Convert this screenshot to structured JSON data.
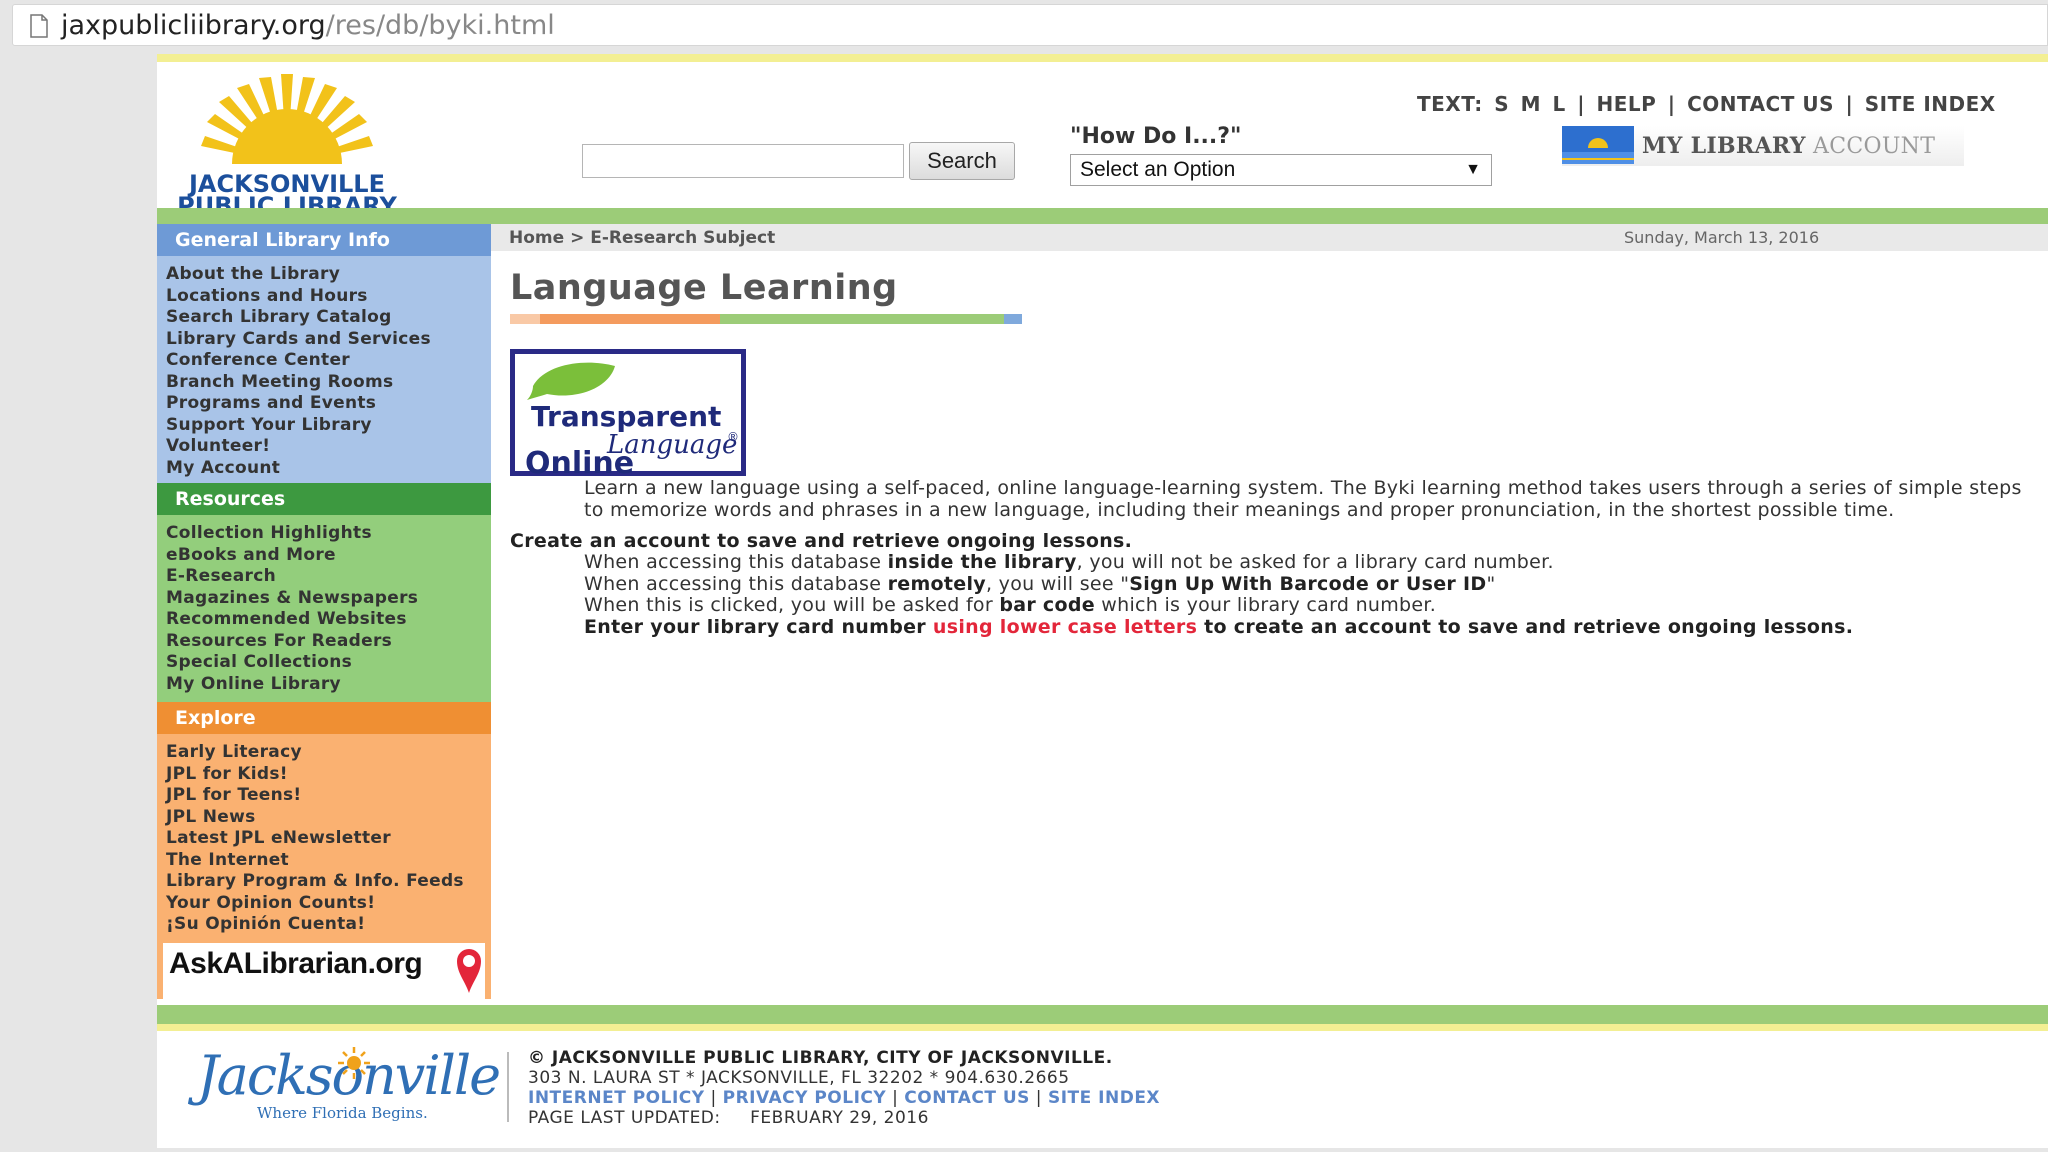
{
  "browser": {
    "url_host": "jaxpublicliibrary.org",
    "url_path": "/res/db/byki.html"
  },
  "header": {
    "logo_line1": "JACKSONVILLE",
    "logo_line2": "PUBLIC LIBRARY",
    "search_button": "Search",
    "search_value": "",
    "howdo_label": "\"How Do I...?\"",
    "select_value": "Select an Option",
    "toplinks": {
      "text_label": "TEXT:",
      "s": "S",
      "m": "M",
      "l": "L",
      "sep": "|",
      "help": "HELP",
      "contact": "CONTACT US",
      "index": "SITE INDEX"
    },
    "account_bold": "MY LIBRARY",
    "account_light": " ACCOUNT"
  },
  "sidebar": {
    "general": {
      "title": "General Library Info",
      "items": [
        "About the Library",
        "Locations and Hours",
        "Search Library Catalog",
        "Library Cards and Services",
        "Conference Center",
        "Branch Meeting Rooms",
        "Programs and Events",
        "Support Your Library",
        "Volunteer!",
        "My Account"
      ]
    },
    "resources": {
      "title": "Resources",
      "items": [
        "Collection Highlights",
        "eBooks and More",
        "E-Research",
        "Magazines & Newspapers",
        "Recommended Websites",
        "Resources For Readers",
        "Special Collections",
        "My Online Library"
      ]
    },
    "explore": {
      "title": "Explore",
      "items": [
        "Early Literacy",
        "JPL for Kids!",
        "JPL for Teens!",
        "JPL News",
        "Latest JPL eNewsletter",
        "The Internet",
        "Library Program & Info. Feeds",
        "Your Opinion Counts!",
        "¡Su Opinión Cuenta!"
      ]
    },
    "ask_label": "AskALibrarian.org"
  },
  "main": {
    "breadcrumb_home": "Home",
    "breadcrumb_sep": " > ",
    "breadcrumb_current": "E-Research Subject",
    "date": "Sunday, March 13, 2016",
    "title": "Language Learning",
    "tl_logo": {
      "line1": "Transparent",
      "line2": "Language",
      "line3": "Online",
      "reg": "®"
    },
    "intro": "Learn a new language using a self-paced, online language-learning system. The Byki learning method takes users through a series of simple steps to memorize words and phrases in a new language, including their meanings and proper pronunciation, in the shortest possible time.",
    "create_heading": "Create an account to save and retrieve ongoing lessons.",
    "line1_a": "When accessing this database ",
    "line1_b": "inside the library",
    "line1_c": ", you will not be asked for a library card number.",
    "line2_a": "When accessing this database ",
    "line2_b": "remotely",
    "line2_c": ", you will see \"",
    "line2_d": "Sign Up With Barcode or User ID",
    "line2_e": "\"",
    "line3_a": "When this is clicked, you will be asked for ",
    "line3_b": "bar code",
    "line3_c": " which is your library card number.",
    "line4_a": "Enter your library card number ",
    "line4_b": "using lower case letters",
    "line4_c": " to create an account to save and retrieve ongoing lessons."
  },
  "footer": {
    "jax_logo_text": "Jacksonville",
    "jax_logo_tagline": "Where Florida Begins.",
    "copyright": "© JACKSONVILLE PUBLIC LIBRARY, CITY OF JACKSONVILLE.",
    "address": "303 N. LAURA ST * JACKSONVILLE, FL 32202 * 904.630.2665",
    "links": [
      "INTERNET POLICY",
      "PRIVACY POLICY",
      "CONTACT US",
      "SITE INDEX"
    ],
    "sep": " | ",
    "updated_label": "PAGE LAST UPDATED:",
    "updated_date": "FEBRUARY 29, 2016"
  },
  "colors": {
    "general_head": "#6e9ad6",
    "resources_head": "#3d9940",
    "explore_head": "#ef8f33",
    "green_bar": "#9ccc78",
    "link_red": "#e3263a",
    "link_blue": "#5b86c8"
  }
}
